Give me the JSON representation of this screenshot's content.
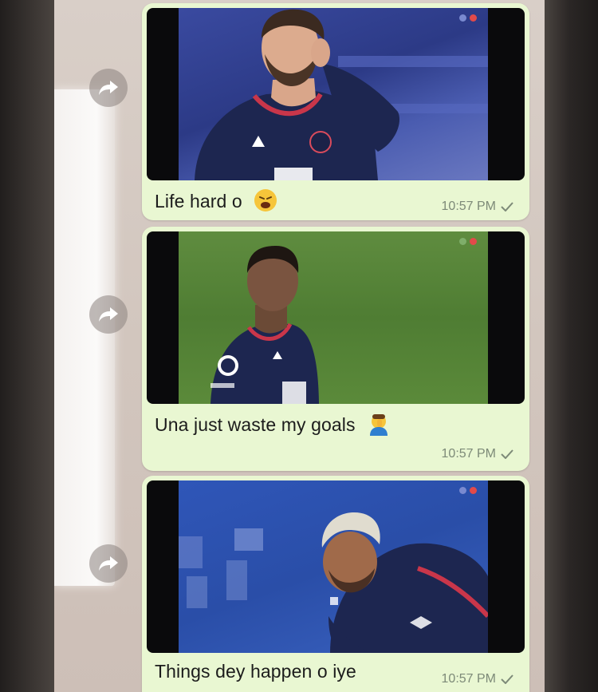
{
  "colors": {
    "bubble": "#e9f7d2",
    "chat_background": "#d2c6be",
    "time_text": "#7d8a78",
    "jersey_navy": "#1d2650",
    "pitch_green": "#5b8a3a"
  },
  "messages": [
    {
      "caption": "Life hard o",
      "emoji": "weary-face-emoji",
      "time": "10:57 PM",
      "status_icon": "single-check-icon",
      "image_subject": "player-scratching-head-navy-jersey"
    },
    {
      "caption": "Una just waste my goals",
      "emoji": "person-facepalming-emoji",
      "time": "10:57 PM",
      "status_icon": "single-check-icon",
      "image_subject": "player-on-green-pitch-navy-jersey"
    },
    {
      "caption": "Things dey happen o iye",
      "emoji": "",
      "time": "10:57 PM",
      "status_icon": "single-check-icon",
      "image_subject": "blond-player-crouching-navy-jersey"
    }
  ]
}
